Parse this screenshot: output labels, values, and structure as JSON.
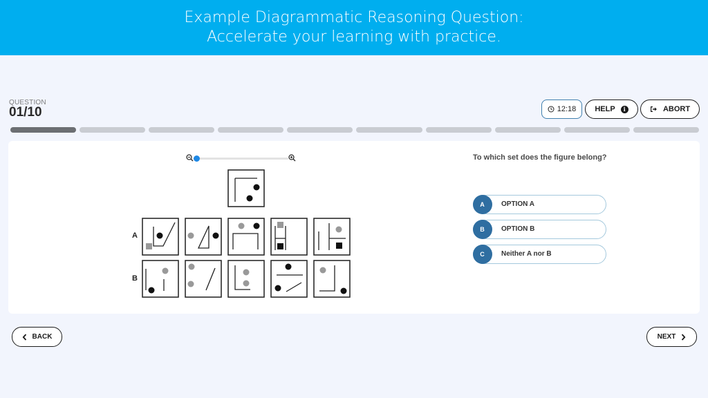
{
  "banner": {
    "line1": "Example Diagrammatic Reasoning Question:",
    "line2": "Accelerate your learning with practice."
  },
  "question_header": {
    "label": "QUESTION",
    "number": "01/10"
  },
  "toolbar": {
    "timer_icon": "clock-icon",
    "timer": "12:18",
    "help_label": "HELP",
    "help_icon": "info-icon",
    "abort_label": "ABORT",
    "abort_icon": "exit-icon"
  },
  "progress": {
    "current": 1,
    "total": 10
  },
  "zoom": {
    "level": 0,
    "zoom_out_icon": "zoom-out-icon",
    "zoom_in_icon": "zoom-in-icon"
  },
  "puzzle": {
    "row_labels": [
      "A",
      "B"
    ]
  },
  "question_text": "To which set does the figure belong?",
  "options": [
    {
      "key": "A",
      "label": "OPTION A"
    },
    {
      "key": "B",
      "label": "OPTION B"
    },
    {
      "key": "C",
      "label": "Neither A nor B"
    }
  ],
  "navigation": {
    "back_label": "BACK",
    "next_label": "NEXT"
  }
}
